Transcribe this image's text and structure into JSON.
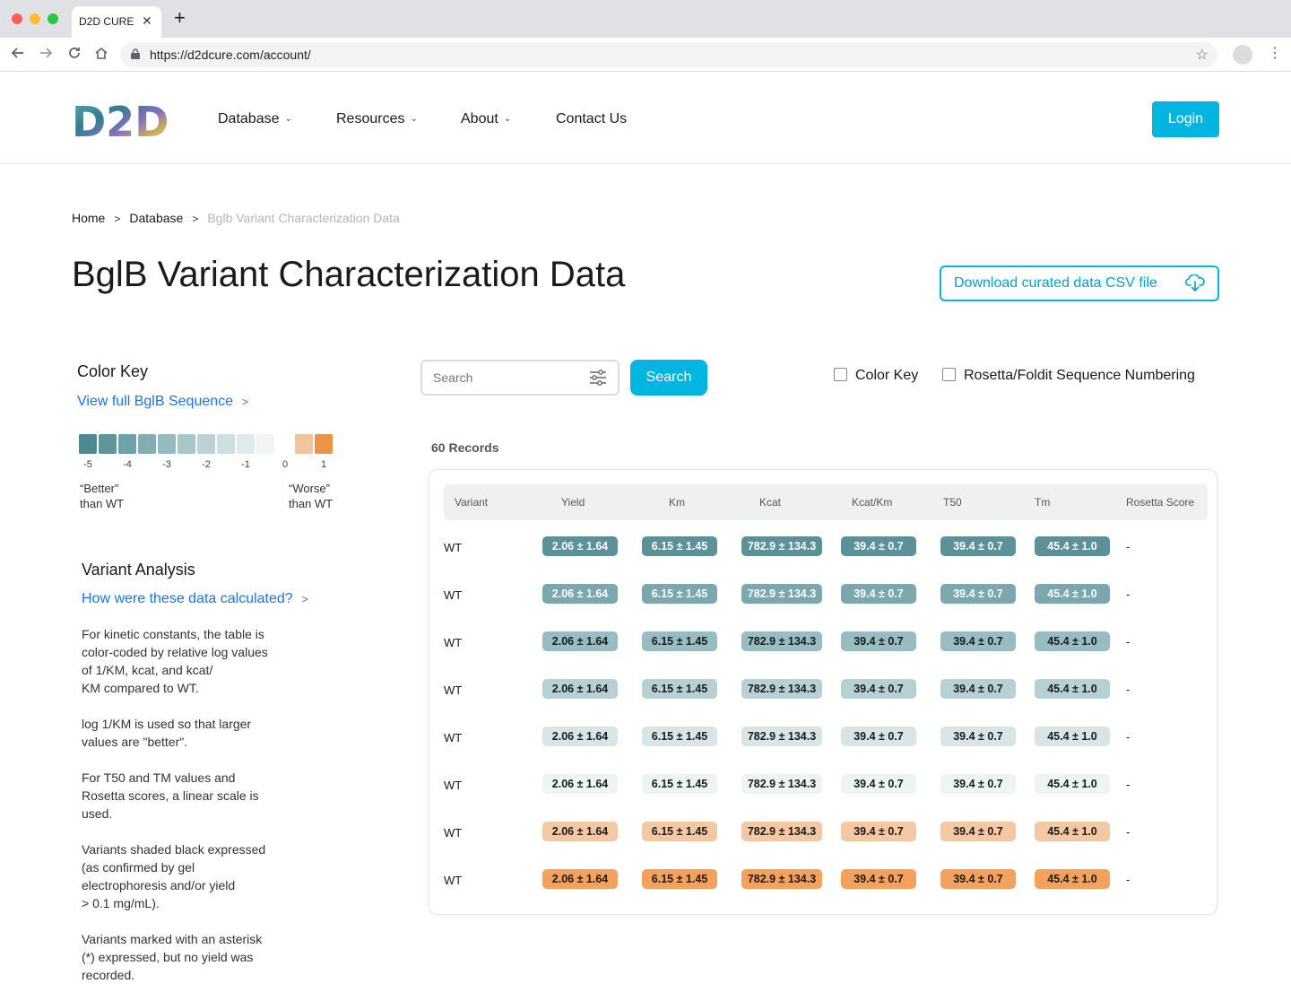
{
  "browser": {
    "tab_title": "D2D CURE",
    "tab_close": "✕",
    "new_tab": "+",
    "url": "https://d2dcure.com/account/"
  },
  "header": {
    "logo_text": "D2D",
    "nav": [
      {
        "label": "Database",
        "has_dropdown": true
      },
      {
        "label": "Resources",
        "has_dropdown": true
      },
      {
        "label": "About",
        "has_dropdown": true
      },
      {
        "label": "Contact Us",
        "has_dropdown": false
      }
    ],
    "login_label": "Login"
  },
  "breadcrumb": [
    "Home",
    "Database",
    "Bglb Variant Characterization Data"
  ],
  "page_title": "BglB Variant Characterization Data",
  "download_label": "Download curated data CSV file",
  "color_key": {
    "title": "Color Key",
    "sequence_link": "View full BglB Sequence",
    "swatches": [
      "#4e8a92",
      "#5e969e",
      "#6fa2a9",
      "#82aeb4",
      "#95babf",
      "#a8c7cb",
      "#bbd3d6",
      "#cddfe2",
      "#e0eaec",
      "#f0f4f5",
      "#ffffff",
      "#f2c49c",
      "#ea9449"
    ],
    "labels": [
      "-5",
      "-4",
      "-3",
      "-2",
      "-1",
      "0",
      "1"
    ],
    "better": [
      "“Better”",
      "than WT"
    ],
    "worse": [
      "“Worse”",
      "than WT"
    ]
  },
  "variant_analysis": {
    "title": "Variant Analysis",
    "link": "How were these data calculated?",
    "paragraphs": [
      [
        "For kinetic constants, the table is",
        "color-coded by relative log values",
        "of 1/KM, kcat, and kcat/",
        "KM compared to WT."
      ],
      [
        "log 1/KM is used so that larger",
        "values are \"better\"."
      ],
      [
        "For T50 and TM values and",
        "Rosetta scores, a linear scale is",
        "used."
      ],
      [
        "Variants shaded black expressed",
        "(as confirmed by gel",
        "electrophoresis and/or yield",
        "> 0.1 mg/mL)."
      ],
      [
        "Variants marked with an asterisk",
        "(*) expressed, but no yield was",
        "recorded."
      ]
    ]
  },
  "search": {
    "placeholder": "Search",
    "button_label": "Search"
  },
  "filters": [
    "Color Key",
    "Rosetta/Foldit Sequence Numbering"
  ],
  "records_label": "60 Records",
  "table": {
    "columns": [
      "Variant",
      "Yield",
      "Km",
      "Kcat",
      "Kcat/Km",
      "T50",
      "Tm",
      "Rosetta Score"
    ],
    "rows": [
      {
        "variant": "WT",
        "values": [
          "2.06 ± 1.64",
          "6.15 ± 1.45",
          "782.9 ± 134.3",
          "39.4 ± 0.7",
          "39.4 ± 0.7",
          "45.4 ± 1.0"
        ],
        "rosetta": "-",
        "bg": "#5b9199",
        "fg": "#ffffff"
      },
      {
        "variant": "WT",
        "values": [
          "2.06 ± 1.64",
          "6.15 ± 1.45",
          "782.9 ± 134.3",
          "39.4 ± 0.7",
          "39.4 ± 0.7",
          "45.4 ± 1.0"
        ],
        "rosetta": "-",
        "bg": "#7aa8ae",
        "fg": "#ffffff"
      },
      {
        "variant": "WT",
        "values": [
          "2.06 ± 1.64",
          "6.15 ± 1.45",
          "782.9 ± 134.3",
          "39.4 ± 0.7",
          "39.4 ± 0.7",
          "45.4 ± 1.0"
        ],
        "rosetta": "-",
        "bg": "#97bcc1",
        "fg": "#1a1a1a"
      },
      {
        "variant": "WT",
        "values": [
          "2.06 ± 1.64",
          "6.15 ± 1.45",
          "782.9 ± 134.3",
          "39.4 ± 0.7",
          "39.4 ± 0.7",
          "45.4 ± 1.0"
        ],
        "rosetta": "-",
        "bg": "#b7d0d3",
        "fg": "#1a1a1a"
      },
      {
        "variant": "WT",
        "values": [
          "2.06 ± 1.64",
          "6.15 ± 1.45",
          "782.9 ± 134.3",
          "39.4 ± 0.7",
          "39.4 ± 0.7",
          "45.4 ± 1.0"
        ],
        "rosetta": "-",
        "bg": "#d8e5e7",
        "fg": "#1a1a1a"
      },
      {
        "variant": "WT",
        "values": [
          "2.06 ± 1.64",
          "6.15 ± 1.45",
          "782.9 ± 134.3",
          "39.4 ± 0.7",
          "39.4 ± 0.7",
          "45.4 ± 1.0"
        ],
        "rosetta": "-",
        "bg": "#eef3f4",
        "fg": "#1a1a1a"
      },
      {
        "variant": "WT",
        "values": [
          "2.06 ± 1.64",
          "6.15 ± 1.45",
          "782.9 ± 134.3",
          "39.4 ± 0.7",
          "39.4 ± 0.7",
          "45.4 ± 1.0"
        ],
        "rosetta": "-",
        "bg": "#f3c8a2",
        "fg": "#1a1a1a"
      },
      {
        "variant": "WT",
        "values": [
          "2.06 ± 1.64",
          "6.15 ± 1.45",
          "782.9 ± 134.3",
          "39.4 ± 0.7",
          "39.4 ± 0.7",
          "45.4 ± 1.0"
        ],
        "rosetta": "-",
        "bg": "#f4a15e",
        "fg": "#1a1a1a"
      }
    ]
  }
}
